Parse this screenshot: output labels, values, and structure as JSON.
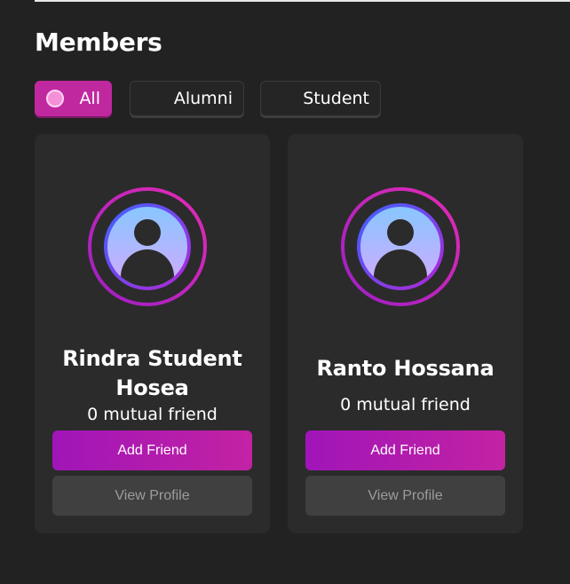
{
  "page": {
    "title": "Members"
  },
  "filters": [
    {
      "label": "All",
      "active": true
    },
    {
      "label": "Alumni",
      "active": false
    },
    {
      "label": "Student",
      "active": false
    }
  ],
  "members": [
    {
      "name_line1": "Rindra Student",
      "name_line2": "Hosea",
      "mutual": "0 mutual friend",
      "add_label": "Add Friend",
      "view_label": "View Profile",
      "avatar_icon": "user-avatar-icon"
    },
    {
      "name_line1": "Ranto Hossana",
      "name_line2": "",
      "mutual": "0 mutual friend",
      "add_label": "Add Friend",
      "view_label": "View Profile",
      "avatar_icon": "user-avatar-icon"
    }
  ],
  "colors": {
    "background": "#222222",
    "card": "#2b2b2b",
    "accent": "#c0289f",
    "add_button_start": "#a015b8",
    "add_button_end": "#c322a3",
    "view_button": "#404040"
  }
}
